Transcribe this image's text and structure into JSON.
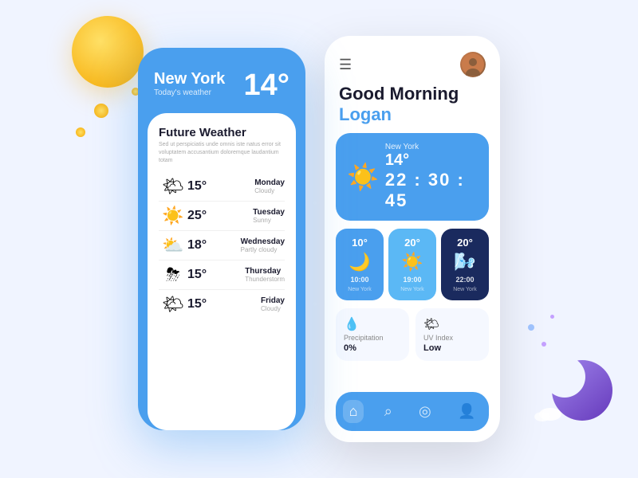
{
  "decorative": {
    "sun_alt": "sun decoration"
  },
  "phone1": {
    "city": "New York",
    "subtitle": "Today's weather",
    "temp": "14°",
    "card": {
      "title": "Future Weather",
      "subtitle": "Sed ut perspiciatis unde omnis iste natus error sit voluptatem accusantium doloremque laudantium totam",
      "rows": [
        {
          "icon": "🌤",
          "temp": "15°",
          "day": "Monday",
          "desc": "Cloudy"
        },
        {
          "icon": "☀️",
          "temp": "25°",
          "day": "Tuesday",
          "desc": "Sunny"
        },
        {
          "icon": "⛅",
          "temp": "18°",
          "day": "Wednesday",
          "desc": "Partly cloudy"
        },
        {
          "icon": "⛈",
          "temp": "15°",
          "day": "Thursday",
          "desc": "Thunderstorm"
        },
        {
          "icon": "🌤",
          "temp": "15°",
          "day": "Friday",
          "desc": "Cloudy"
        }
      ]
    }
  },
  "phone2": {
    "greeting": "Good Morning",
    "name": "Logan",
    "menu_icon": "☰",
    "main_card": {
      "city": "New York",
      "temp": "14°",
      "time": "22 : 30 : 45"
    },
    "time_cards": [
      {
        "temp": "10°",
        "icon": "🌙",
        "time": "10:00",
        "city": "New York",
        "style": "cold"
      },
      {
        "temp": "20°",
        "icon": "☀️",
        "time": "19:00",
        "city": "New York",
        "style": "warm"
      },
      {
        "temp": "20°",
        "icon": "🌬",
        "time": "22:00",
        "city": "New York",
        "style": "night"
      }
    ],
    "stats": [
      {
        "icon": "💧",
        "label": "Precipitation",
        "value": "0%"
      },
      {
        "icon": "🌤",
        "label": "UV Index",
        "value": "Low"
      }
    ],
    "navbar": [
      {
        "icon": "⌂",
        "label": "home",
        "active": true
      },
      {
        "icon": "⌕",
        "label": "search",
        "active": false
      },
      {
        "icon": "◎",
        "label": "location",
        "active": false
      },
      {
        "icon": "👤",
        "label": "profile",
        "active": false
      }
    ]
  }
}
